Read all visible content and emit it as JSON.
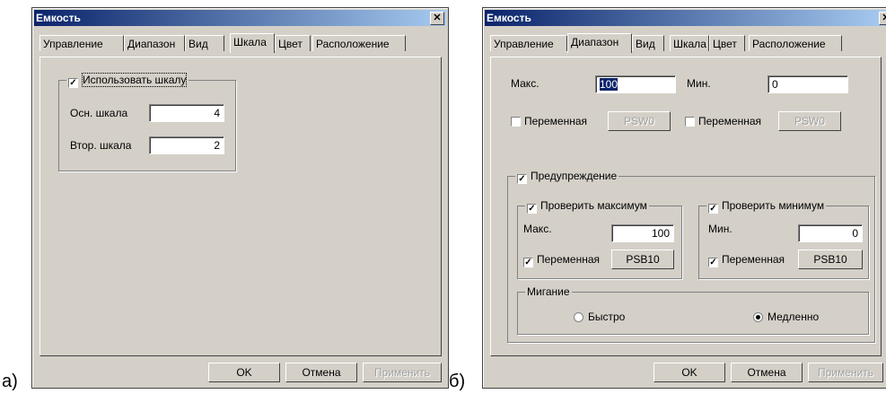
{
  "captions": {
    "a": "а)",
    "b": "б)"
  },
  "left_window": {
    "title": "Емкость",
    "tabs": [
      "Управление",
      "Диапазон",
      "Вид",
      "Шкала",
      "Цвет",
      "Расположение"
    ],
    "active_tab": "Шкала",
    "use_scale_label": "Использовать шкалу",
    "use_scale_checked": true,
    "main_scale_label": "Осн. шкала",
    "main_scale_value": "4",
    "second_scale_label": "Втор. шкала",
    "second_scale_value": "2",
    "ok": "OK",
    "cancel": "Отмена",
    "apply": "Применить"
  },
  "right_window": {
    "title": "Емкость",
    "tabs": [
      "Управление",
      "Диапазон",
      "Вид",
      "Шкала",
      "Цвет",
      "Расположение"
    ],
    "active_tab": "Диапазон",
    "max_label": "Макс.",
    "max_value": "100",
    "min_label": "Мин.",
    "min_value": "0",
    "variable_label": "Переменная",
    "psw_max": "PSW0",
    "psw_min": "PSW0",
    "warning_label": "Предупреждение",
    "check_max_label": "Проверить максимум",
    "check_min_label": "Проверить минимум",
    "warn_max_label": "Макс.",
    "warn_max_value": "100",
    "warn_min_label": "Мин.",
    "warn_min_value": "0",
    "psb_max": "PSB10",
    "psb_min": "PSB10",
    "blink_label": "Мигание",
    "fast_label": "Быстро",
    "slow_label": "Медленно",
    "blink_selected": "Медленно",
    "ok": "OK",
    "cancel": "Отмена",
    "apply": "Применить"
  }
}
